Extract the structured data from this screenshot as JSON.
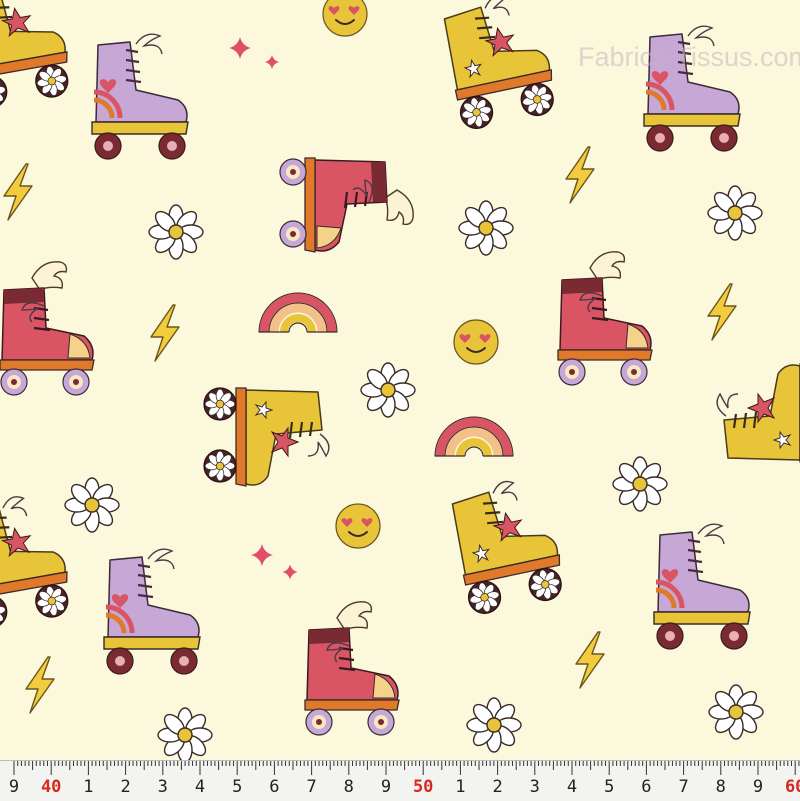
{
  "watermark": "Fabrics·Tissus.com",
  "colors": {
    "background": "#fbf8dc",
    "pink": "#d95564",
    "lavender": "#c7a7d6",
    "mustard": "#e8c439",
    "maroon": "#7a2a32",
    "orange": "#e07a2a",
    "peach": "#f4d28a",
    "ruler_red": "#d6281e"
  },
  "pattern": {
    "motifs": [
      "roller-skate",
      "winged-roller-skate",
      "daisy",
      "lightning-bolt",
      "rainbow",
      "smiley-heart-eyes",
      "sparkle-star"
    ]
  },
  "ruler": {
    "labels": [
      "9",
      "40",
      "1",
      "2",
      "3",
      "4",
      "5",
      "6",
      "7",
      "8",
      "9",
      "50",
      "1",
      "2",
      "3",
      "4",
      "5",
      "6",
      "7",
      "8",
      "9",
      "60"
    ],
    "major": [
      "40",
      "50",
      "60"
    ],
    "unit_marks": [
      "cm",
      "cm"
    ]
  }
}
